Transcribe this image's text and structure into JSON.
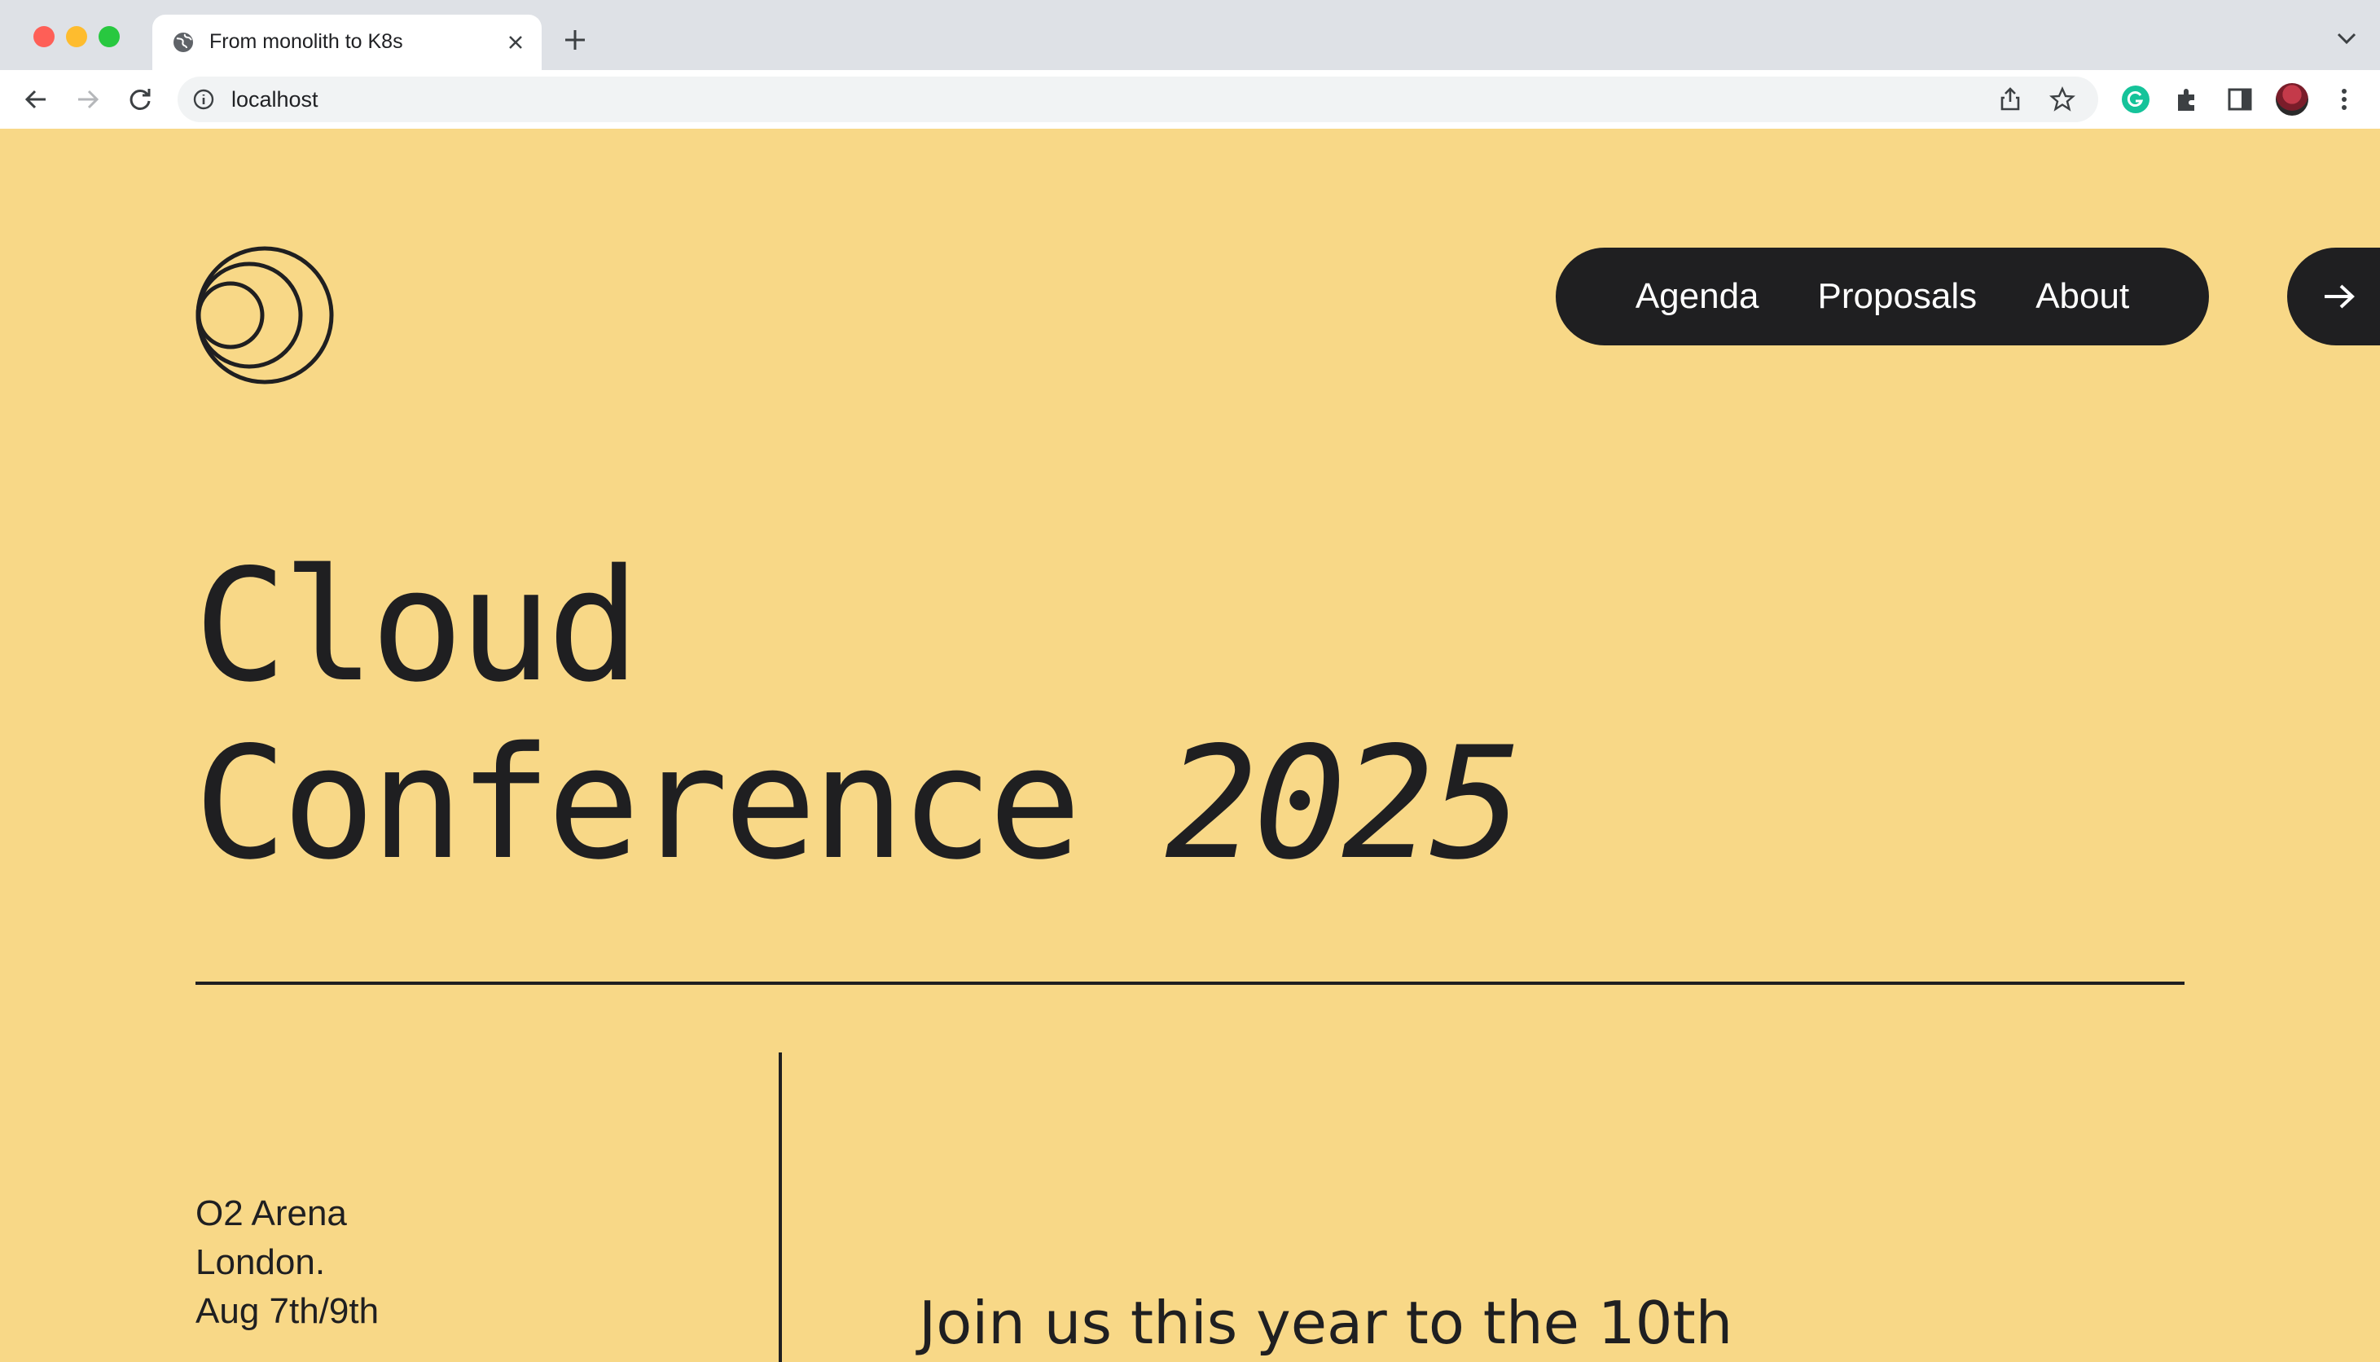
{
  "browser": {
    "tab_title": "From monolith to K8s",
    "url": "localhost"
  },
  "nav": {
    "links": [
      "Agenda",
      "Proposals",
      "About"
    ],
    "arrow": "→"
  },
  "hero": {
    "title_line1": "Cloud",
    "title_line2": "Conference",
    "title_year": "2025"
  },
  "venue": {
    "line1": "O2 Arena",
    "line2": "London.",
    "line3": "Aug 7th/9th"
  },
  "intro": "Join us this year to the 10th",
  "colors": {
    "page_bg": "#f8d887",
    "ink": "#1f1f21"
  }
}
